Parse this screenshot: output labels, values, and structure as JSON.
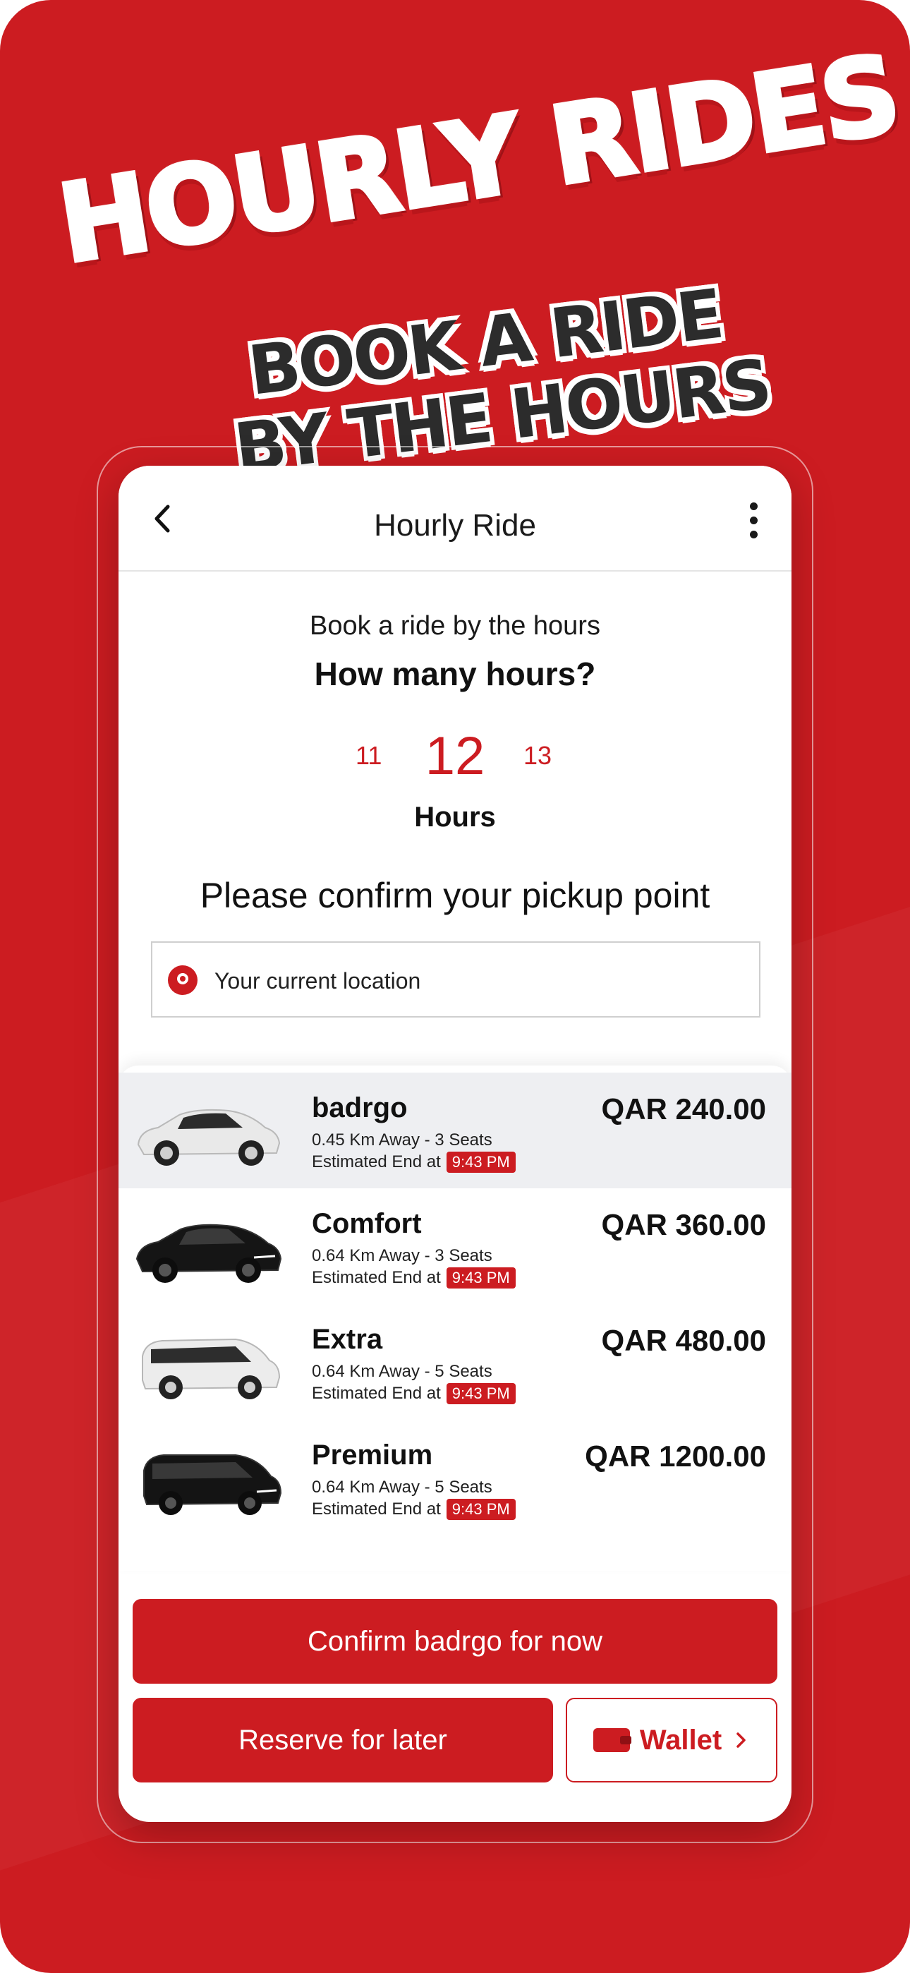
{
  "promo": {
    "headline": "HOURLY RIDES",
    "subline_1": "BOOK A RIDE",
    "subline_2": "BY THE HOURS"
  },
  "header": {
    "title": "Hourly Ride",
    "back_icon": "chevron-left-icon",
    "menu_icon": "kebab-menu-icon"
  },
  "hours": {
    "subtitle": "Book a ride by the hours",
    "question": "How many hours?",
    "prev": "11",
    "selected": "12",
    "next": "13",
    "unit": "Hours"
  },
  "pickup": {
    "title": "Please confirm your pickup point",
    "location": "Your current location",
    "icon": "location-pin-icon"
  },
  "rides": [
    {
      "name": "badrgo",
      "distance": "0.45  Km Away - 3 Seats",
      "end_label": "Estimated End at",
      "end_time": "9:43 PM",
      "price": "QAR 240.00",
      "selected": true
    },
    {
      "name": "Comfort",
      "distance": "0.64  Km Away - 3 Seats",
      "end_label": "Estimated End at",
      "end_time": "9:43 PM",
      "price": "QAR 360.00",
      "selected": false
    },
    {
      "name": "Extra",
      "distance": "0.64  Km Away - 5 Seats",
      "end_label": "Estimated End at",
      "end_time": "9:43 PM",
      "price": "QAR 480.00",
      "selected": false
    },
    {
      "name": "Premium",
      "distance": "0.64  Km Away - 5 Seats",
      "end_label": "Estimated End at",
      "end_time": "9:43 PM",
      "price": "QAR 1200.00",
      "selected": false
    }
  ],
  "actions": {
    "confirm": "Confirm badrgo for now",
    "reserve": "Reserve for later",
    "wallet": "Wallet"
  },
  "colors": {
    "brand_red": "#cc1c21",
    "selected_row": "#eeeff2"
  }
}
